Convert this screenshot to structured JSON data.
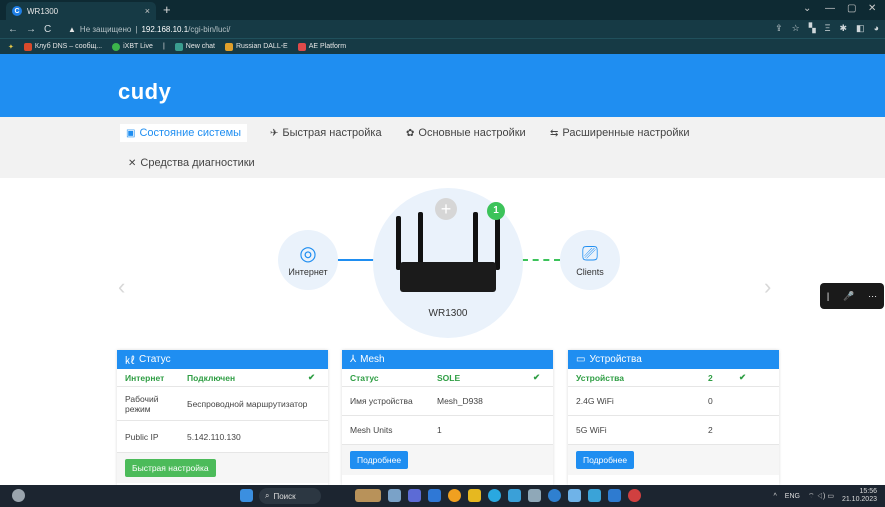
{
  "browser": {
    "tab_title": "WR1300",
    "tab_favicon": "C",
    "tab_close": "×",
    "new_tab": "+",
    "window_controls": [
      "⌄",
      "—",
      "▢",
      "✕"
    ],
    "nav": {
      "back": "←",
      "forward": "→",
      "reload": "C"
    },
    "url_warning_icon": "▲",
    "url_insecure": "Не защищено",
    "url_separator": "|",
    "url_host": "192.168.10.1",
    "url_path": "/cgi-bin/luci/",
    "bookmarks": [
      {
        "label": "Клуб DNS – сообщ...",
        "icon": "K",
        "color": "#d94a2b"
      },
      {
        "label": "iXBT Live",
        "icon": "i",
        "color": "#3cb44b"
      },
      {
        "label": "New chat",
        "icon": "▦",
        "color": "#3a9d8f"
      },
      {
        "label": "Russian DALL-E",
        "icon": "▣",
        "color": "#e0a02b"
      },
      {
        "label": "AE Platform",
        "icon": "▣",
        "color": "#e04a4a"
      }
    ]
  },
  "page": {
    "logo": "cudy",
    "menu": [
      {
        "label": "Состояние системы",
        "icon": "▣"
      },
      {
        "label": "Быстрая настройка",
        "icon": "✈"
      },
      {
        "label": "Основные настройки",
        "icon": "✿"
      },
      {
        "label": "Расширенные настройки",
        "icon": "⇆"
      },
      {
        "label": "Средства диагностики",
        "icon": "✕"
      }
    ],
    "topology": {
      "internet_label": "Интернет",
      "clients_label": "Clients",
      "router_label": "WR1300",
      "badge_count": "1",
      "add_symbol": "+",
      "left_arrow": "‹",
      "right_arrow": "›"
    },
    "float_bar": {
      "items": [
        "|",
        "🎤",
        "···"
      ]
    },
    "status_card": {
      "title": "Статус",
      "icon": "㎘",
      "header_row": {
        "label": "Интернет",
        "value": "Подключен",
        "check": "✔"
      },
      "rows": [
        {
          "label": "Рабочий режим",
          "value": "Беспроводной маршрутизатор"
        },
        {
          "label": "Public IP",
          "value": "5.142.110.130"
        }
      ],
      "button": "Быстрая настройка"
    },
    "mesh_card": {
      "title": "Mesh",
      "icon": "⅄",
      "header_row": {
        "label": "Статус",
        "value": "SOLE",
        "check": "✔"
      },
      "rows": [
        {
          "label": "Имя устройства",
          "value": "Mesh_D938"
        },
        {
          "label": "Mesh Units",
          "value": "1"
        }
      ],
      "button": "Подробнее"
    },
    "devices_card": {
      "title": "Устройства",
      "icon": "▭",
      "header_row": {
        "label": "Устройства",
        "value": "2",
        "check": "✔"
      },
      "rows": [
        {
          "label": "2.4G WiFi",
          "value": "0"
        },
        {
          "label": "5G WiFi",
          "value": "2"
        }
      ],
      "button": "Подробнее"
    }
  },
  "taskbar": {
    "search_label": "Поиск",
    "tray_lang": "ENG",
    "tray_up": "^",
    "tray_icons": "⌔ ◁) ▭",
    "time": "15:56",
    "date": "21.10.2023"
  }
}
